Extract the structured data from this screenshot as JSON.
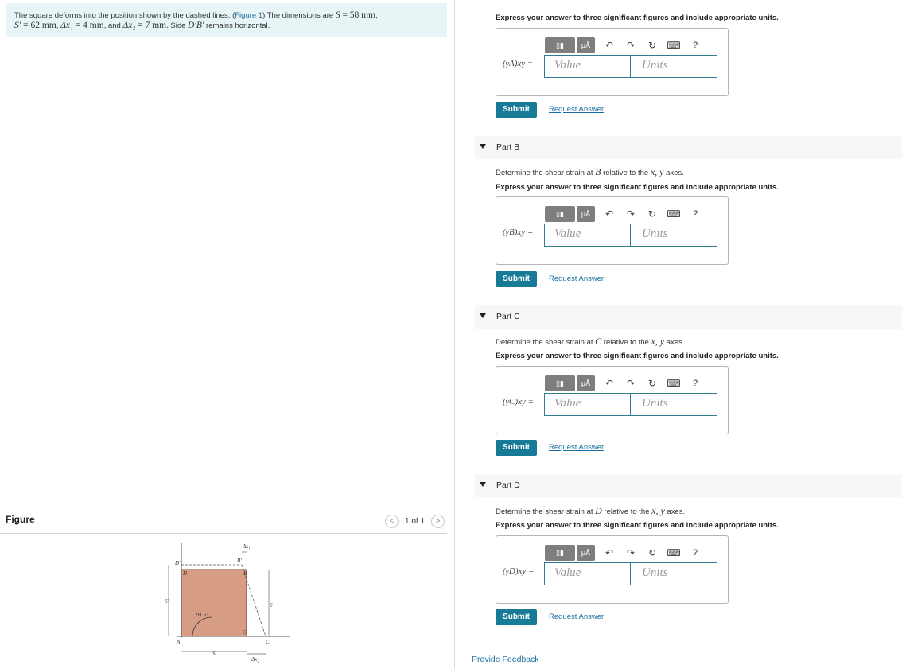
{
  "problem": {
    "t1": "The square deforms into the position shown by the dashed lines. (",
    "figure_link": "Figure 1",
    "t2": ") The dimensions are ",
    "S_sym": "S",
    "eq1": " = 58 mm",
    "comma1": ", ",
    "Sp_sym": "S′",
    "eq2": " = 62 mm",
    "comma2": ", ",
    "dx1_sym": "Δx₁",
    "eq3": " = 4 mm",
    "and": ", and ",
    "dx2_sym": "Δx₂",
    "eq4": " = 7 mm",
    "t3": ". Side ",
    "side_sym": "D′B′",
    "t4": " remains horizontal."
  },
  "figure_panel": {
    "title": "Figure",
    "pager_text": "1 of 1",
    "labels": {
      "d_prime": "D′",
      "d": "D",
      "b_prime": "B′",
      "b": "B",
      "dx1": "Δx₁",
      "s_prime": "S′",
      "s_right": "S",
      "angle": "91.5°",
      "a": "A",
      "c": "C",
      "c_prime": "C′",
      "s_bottom": "S",
      "dx2": "Δx₂"
    }
  },
  "common": {
    "instruction": "Express your answer to three significant figures and include appropriate units.",
    "value_placeholder": "Value",
    "units_placeholder": "Units",
    "submit_label": "Submit",
    "request_label": "Request Answer",
    "desc_prefix": "Determine the shear strain at ",
    "desc_suffix": " relative to the ",
    "axes": "x, y",
    "desc_end": " axes."
  },
  "partA": {
    "label": "(γA)xy ="
  },
  "partB": {
    "title": "Part B",
    "point": "B",
    "label": "(γB)xy ="
  },
  "partC": {
    "title": "Part C",
    "point": "C",
    "label": "(γC)xy ="
  },
  "partD": {
    "title": "Part D",
    "point": "D",
    "label": "(γD)xy ="
  },
  "toolbar": {
    "templates": "▯▮",
    "units_symbol": "μÅ",
    "undo": "↶",
    "redo": "↷",
    "reset": "↻",
    "keyboard": "⌨",
    "help": "?"
  },
  "feedback": "Provide Feedback"
}
